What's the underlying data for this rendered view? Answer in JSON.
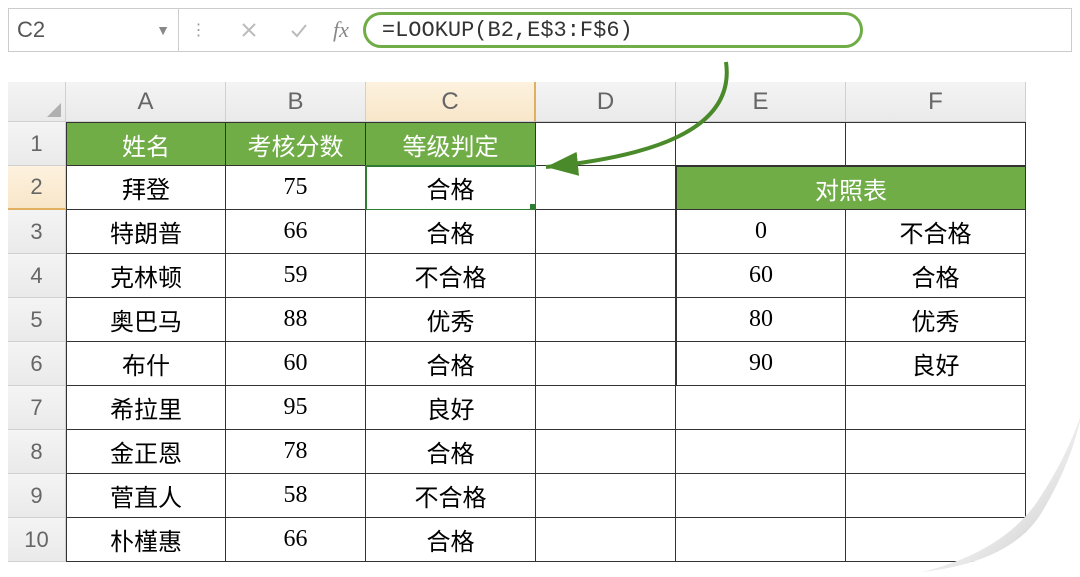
{
  "nameBox": "C2",
  "fxLabel": "fx",
  "formula": "=LOOKUP(B2,E$3:F$6)",
  "colHeaders": [
    "A",
    "B",
    "C",
    "D",
    "E",
    "F"
  ],
  "rowHeaders": [
    "1",
    "2",
    "3",
    "4",
    "5",
    "6",
    "7",
    "8",
    "9",
    "10"
  ],
  "mainTable": {
    "headers": [
      "姓名",
      "考核分数",
      "等级判定"
    ],
    "rows": [
      [
        "拜登",
        "75",
        "合格"
      ],
      [
        "特朗普",
        "66",
        "合格"
      ],
      [
        "克林顿",
        "59",
        "不合格"
      ],
      [
        "奥巴马",
        "88",
        "优秀"
      ],
      [
        "布什",
        "60",
        "合格"
      ],
      [
        "希拉里",
        "95",
        "良好"
      ],
      [
        "金正恩",
        "78",
        "合格"
      ],
      [
        "菅直人",
        "58",
        "不合格"
      ],
      [
        "朴槿惠",
        "66",
        "合格"
      ]
    ]
  },
  "lookupTable": {
    "title": "对照表",
    "rows": [
      [
        "0",
        "不合格"
      ],
      [
        "60",
        "合格"
      ],
      [
        "80",
        "优秀"
      ],
      [
        "90",
        "良好"
      ]
    ]
  },
  "selected": {
    "row": 2,
    "col": "C"
  }
}
